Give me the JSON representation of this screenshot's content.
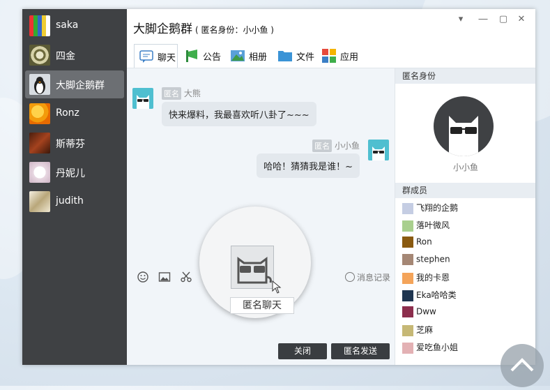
{
  "sidebar": {
    "contacts": [
      {
        "name": "saka"
      },
      {
        "name": "四金"
      },
      {
        "name": "大脚企鹅群",
        "active": true
      },
      {
        "name": "Ronz"
      },
      {
        "name": "斯蒂芬"
      },
      {
        "name": "丹妮儿"
      },
      {
        "name": "judith"
      }
    ]
  },
  "header": {
    "title": "大脚企鹅群",
    "subtitle": "( 匿名身份：小小鱼 )"
  },
  "tabs": [
    {
      "label": "聊天",
      "icon": "chat-icon"
    },
    {
      "label": "公告",
      "icon": "announcement-icon"
    },
    {
      "label": "相册",
      "icon": "album-icon"
    },
    {
      "label": "文件",
      "icon": "folder-icon"
    },
    {
      "label": "应用",
      "icon": "apps-icon"
    }
  ],
  "messages": [
    {
      "tag": "匿名",
      "sender": "大熊",
      "text": "快来爆料，我最喜欢听八卦了~~~"
    },
    {
      "tag": "匿名",
      "sender": "小小鱼",
      "text": "哈哈！猜猜我是谁！~"
    }
  ],
  "toolbar": {
    "record_label": "消息记录"
  },
  "magnifier": {
    "button_label": "匿名聊天"
  },
  "buttons": {
    "close": "关闭",
    "send": "匿名发送"
  },
  "identity_panel": {
    "heading": "匿名身份",
    "name": "小小鱼"
  },
  "members_panel": {
    "heading": "群成员",
    "members": [
      {
        "name": "飞翔的企鹅",
        "color": "#c5cde3"
      },
      {
        "name": "落叶微风",
        "color": "#a9cf8e"
      },
      {
        "name": "Ron",
        "color": "#8a5a10"
      },
      {
        "name": "stephen",
        "color": "#a58775"
      },
      {
        "name": "我的卡恩",
        "color": "#f4a45a"
      },
      {
        "name": "Eka哈哈类",
        "color": "#1f3550"
      },
      {
        "name": "Dww",
        "color": "#8c2e4d"
      },
      {
        "name": "芝麻",
        "color": "#c6b876"
      },
      {
        "name": "爱吃鱼小姐",
        "color": "#e3b1b4"
      }
    ]
  }
}
